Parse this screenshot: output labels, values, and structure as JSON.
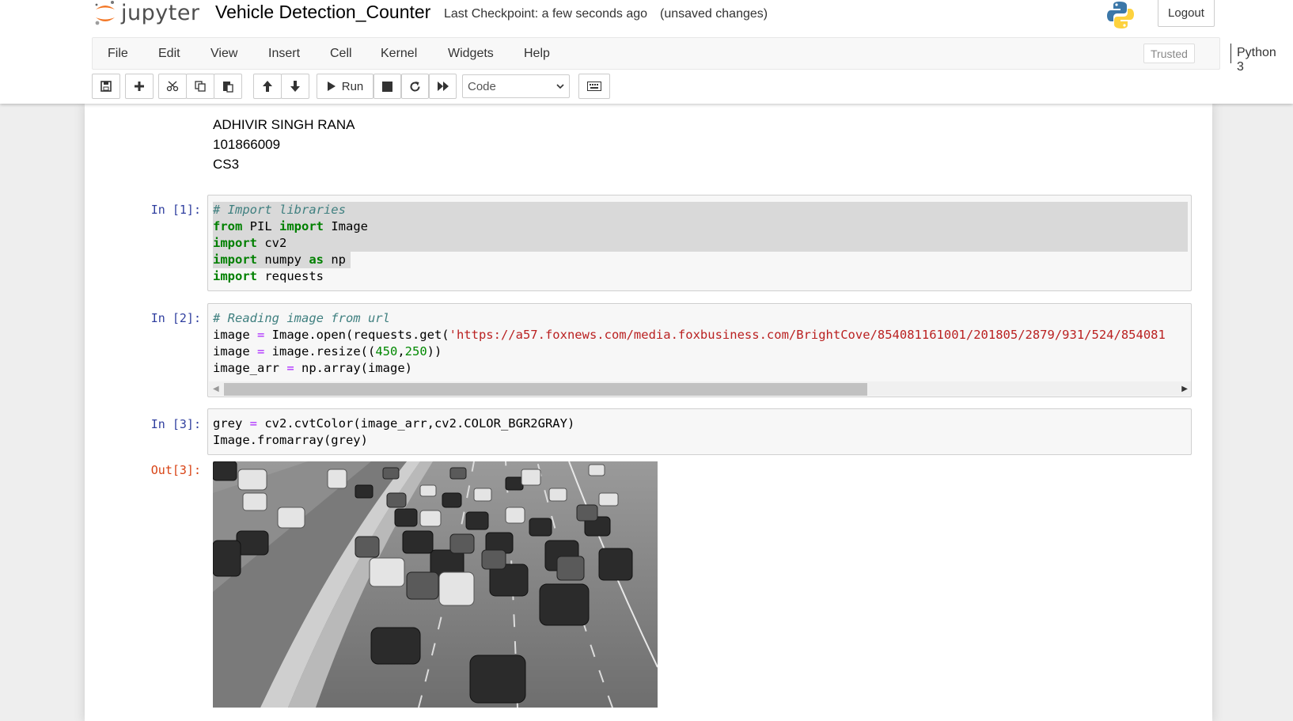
{
  "header": {
    "logo_text": "jupyter",
    "notebook_title": "Vehicle Detection_Counter",
    "checkpoint": "Last Checkpoint: a few seconds ago",
    "autosave": "(unsaved changes)",
    "logout_label": "Logout",
    "python_logo_icon": "python-logo-icon"
  },
  "menubar": {
    "items": [
      "File",
      "Edit",
      "View",
      "Insert",
      "Cell",
      "Kernel",
      "Widgets",
      "Help"
    ],
    "trusted": "Trusted",
    "kernel_name": "Python 3"
  },
  "toolbar": {
    "icons": [
      "save-icon",
      "plus-icon",
      "cut-icon",
      "copy-icon",
      "paste-icon",
      "arrow-up-icon",
      "arrow-down-icon",
      "play-icon",
      "stop-icon",
      "restart-icon",
      "fast-forward-icon",
      "keyboard-icon"
    ],
    "run_label": "Run",
    "cell_type": "Code"
  },
  "markdown": {
    "lines": [
      "ADHIVIR SINGH RANA",
      "101866009",
      "CS3"
    ]
  },
  "cells": [
    {
      "prompt": "In [1]:",
      "lines": [
        "# Import libraries",
        "from PIL import Image",
        "import cv2",
        "import numpy as np",
        "import requests"
      ]
    },
    {
      "prompt": "In [2]:",
      "lines": [
        "# Reading image from url",
        "image = Image.open(requests.get('https://a57.foxnews.com/media.foxbusiness.com/BrightCove/854081161001/201805/2879/931/524/854081",
        "image = image.resize((450,250))",
        "image_arr = np.array(image)"
      ]
    },
    {
      "prompt": "In [3]:",
      "lines": [
        "grey = cv2.cvtColor(image_arr,cv2.COLOR_BGR2GRAY)",
        "Image.fromarray(grey)"
      ],
      "out_prompt": "Out[3]:",
      "output_image": "grayscale-highway-traffic-image"
    }
  ],
  "colors": {
    "in_prompt": "#303f9f",
    "out_prompt": "#d84315",
    "keyword": "#008000",
    "comment": "#408080",
    "string": "#ba2121",
    "operator": "#aa22ff"
  }
}
